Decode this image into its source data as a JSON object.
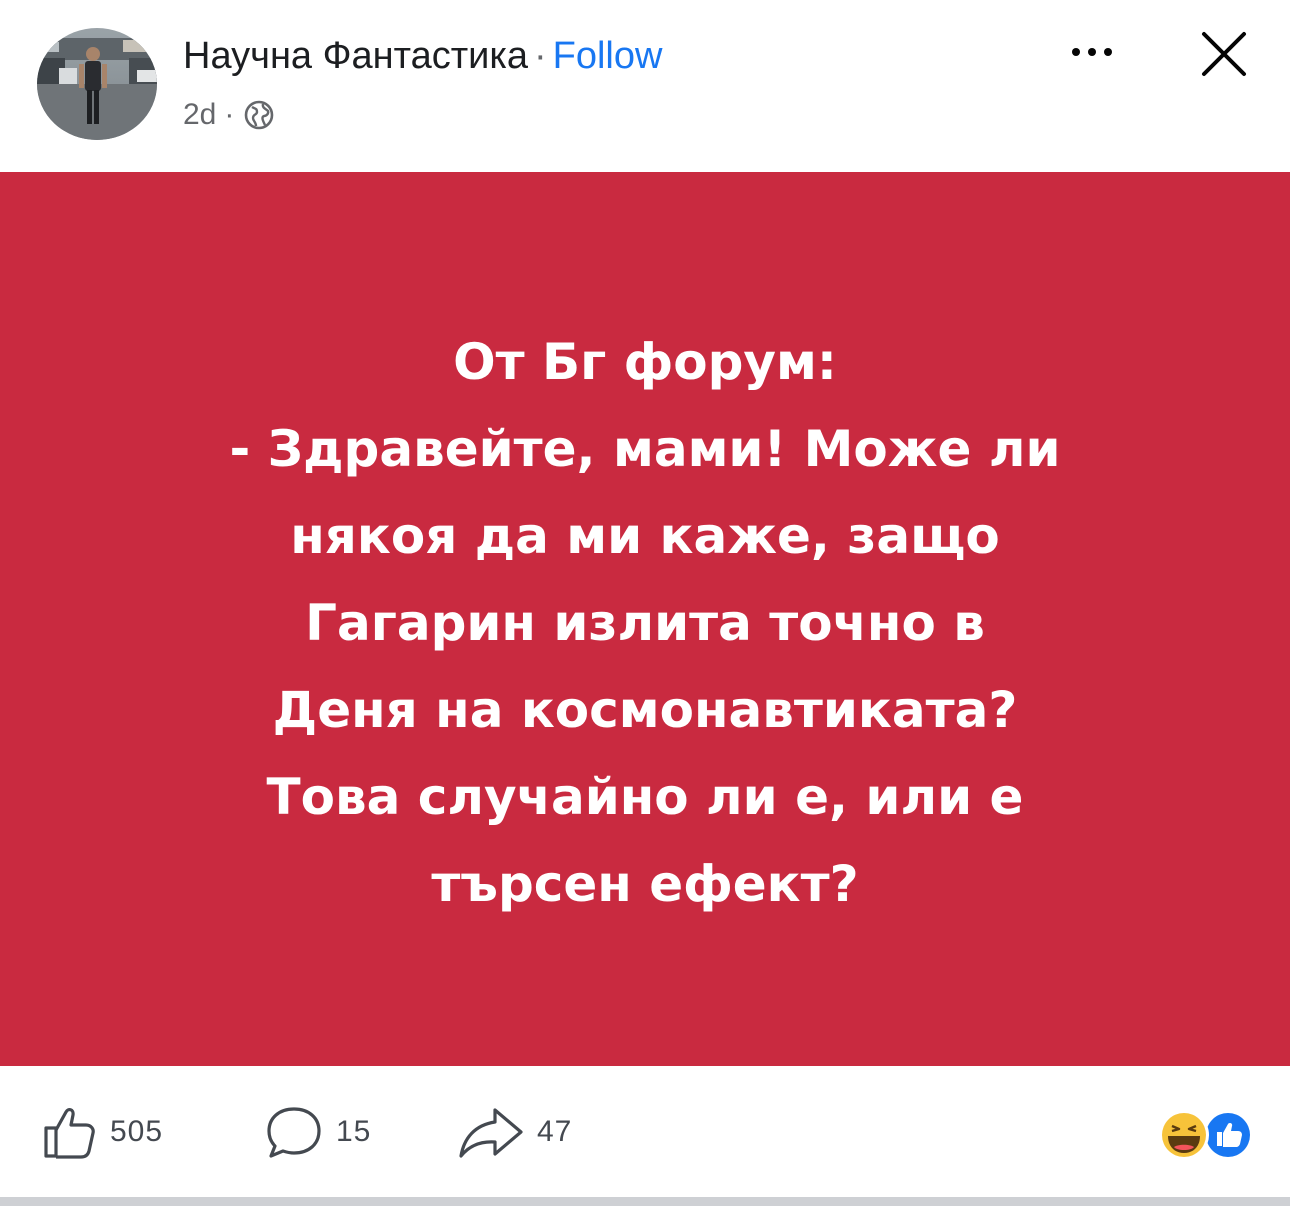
{
  "header": {
    "page_name": "Научна Фантастика",
    "separator": "·",
    "follow_label": "Follow",
    "timestamp": "2d",
    "meta_separator": "·",
    "privacy_icon": "globe-icon",
    "more_icon": "more-horizontal-icon",
    "close_icon": "close-icon"
  },
  "post": {
    "background_color": "#c92a40",
    "text_color": "#ffffff",
    "lines": [
      "От Бг форум:",
      "- Здравейте, мами! Може ли",
      "някоя да ми каже, защо",
      "Гагарин излита точно в",
      "Деня на космонавтиката?",
      "Това случайно ли е, или е",
      "търсен ефект?"
    ]
  },
  "actions": {
    "like_count": "505",
    "comment_count": "15",
    "share_count": "47"
  },
  "reactions": [
    "haha",
    "like"
  ],
  "colors": {
    "accent": "#1877f2",
    "secondary_text": "#65676b",
    "divider": "#ced0d4"
  }
}
